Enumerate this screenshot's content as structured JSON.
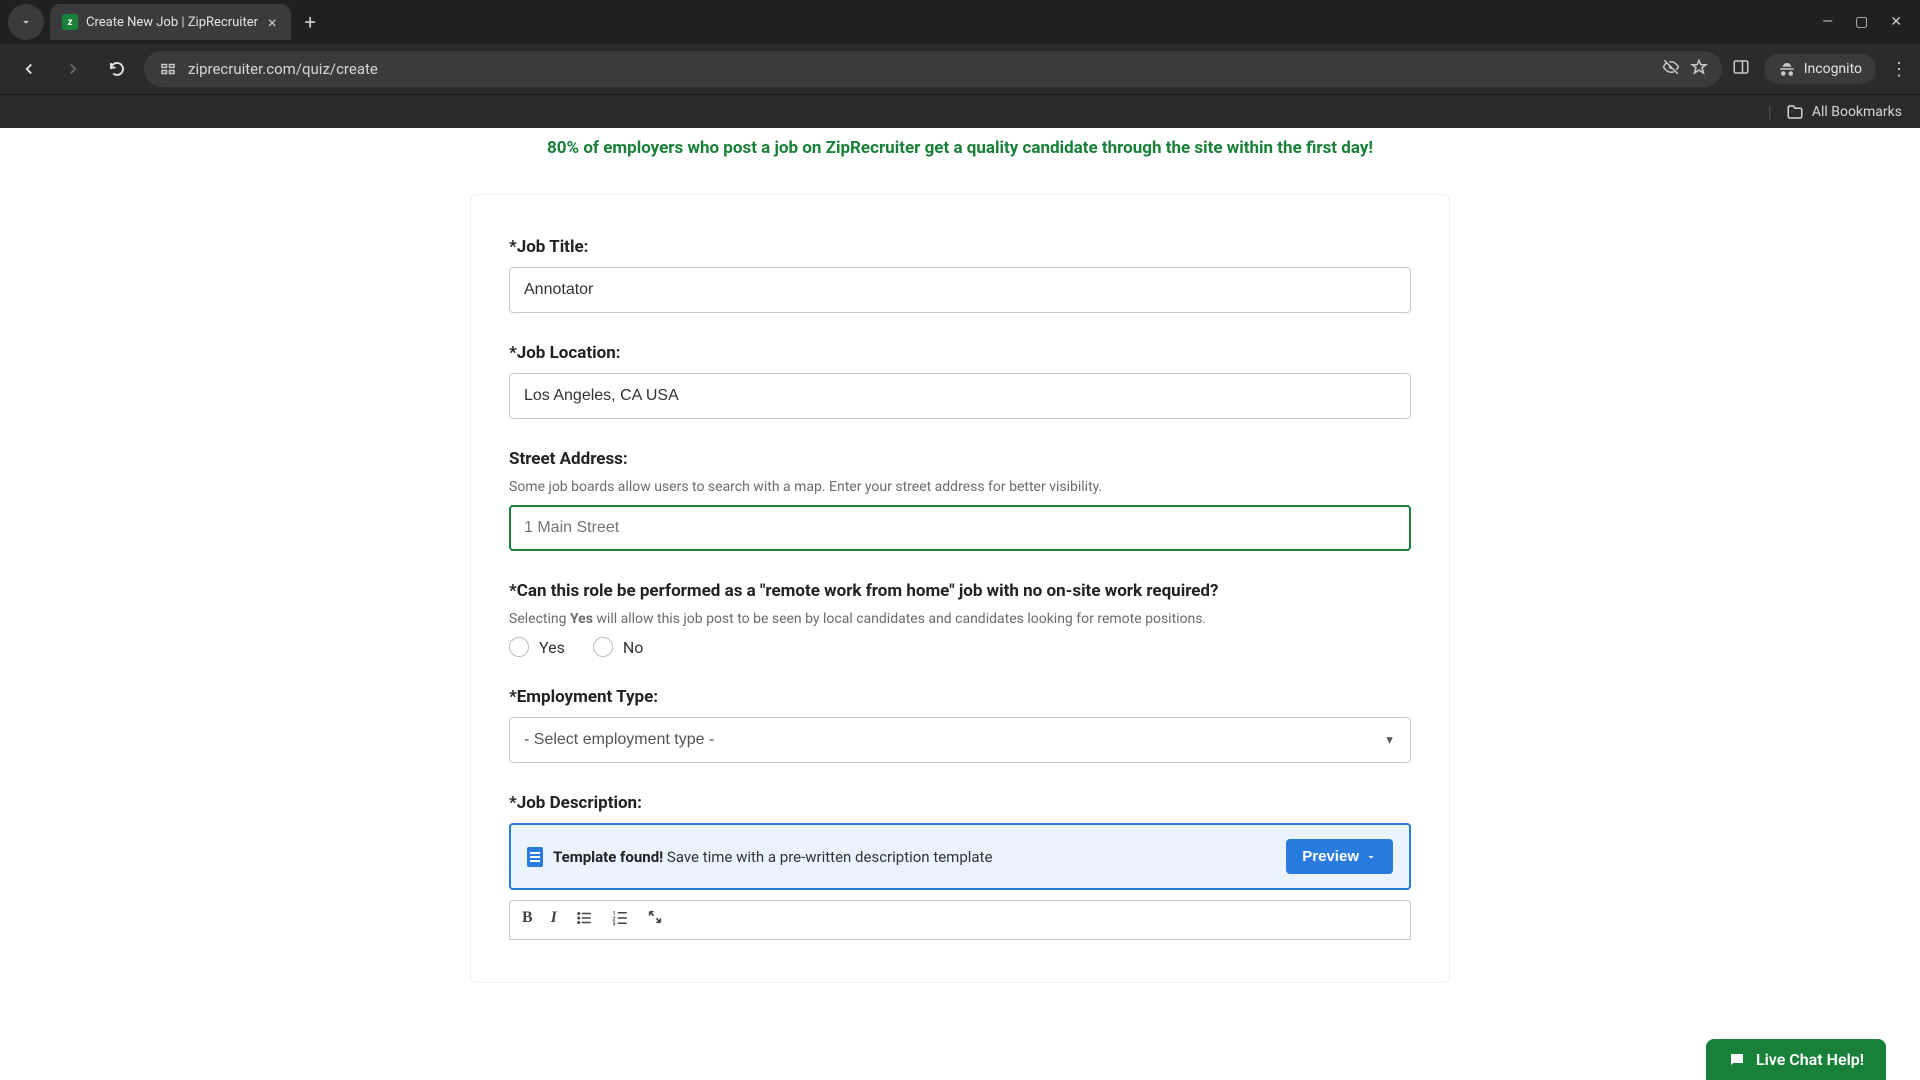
{
  "browser": {
    "tab_title": "Create New Job | ZipRecruiter",
    "url": "ziprecruiter.com/quiz/create",
    "incognito_label": "Incognito",
    "all_bookmarks": "All Bookmarks"
  },
  "banner": "80% of employers who post a job on ZipRecruiter get a quality candidate through the site within the first day!",
  "form": {
    "job_title": {
      "label": "*Job Title:",
      "value": "Annotator"
    },
    "job_location": {
      "label": "*Job Location:",
      "value": "Los Angeles, CA USA"
    },
    "street_address": {
      "label": "Street Address:",
      "help": "Some job boards allow users to search with a map. Enter your street address for better visibility.",
      "placeholder": "1 Main Street"
    },
    "remote": {
      "label": "*Can this role be performed as a \"remote work from home\" job with no on-site work required?",
      "help_prefix": "Selecting ",
      "help_bold": "Yes",
      "help_suffix": " will allow this job post to be seen by local candidates and candidates looking for remote positions.",
      "yes": "Yes",
      "no": "No"
    },
    "employment_type": {
      "label": "*Employment Type:",
      "placeholder": "- Select employment type -"
    },
    "job_description": {
      "label": "*Job Description:"
    },
    "template": {
      "strong": "Template found!",
      "rest": " Save time with a pre-written description template",
      "preview": "Preview"
    }
  },
  "live_chat": "Live Chat Help!"
}
